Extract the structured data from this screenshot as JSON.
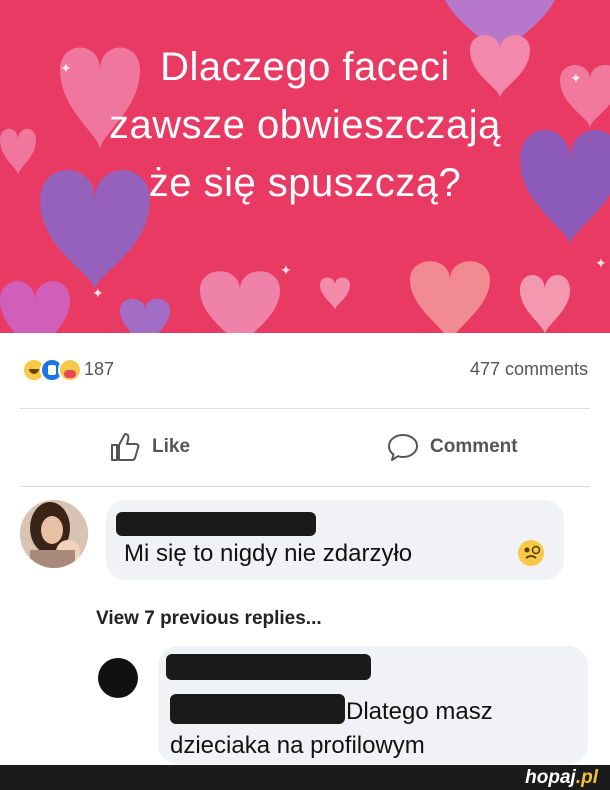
{
  "post": {
    "banner_title_lines": [
      "Dlaczego faceci",
      "zawsze obwieszczają",
      "że się spuszczą?"
    ],
    "reaction_count": "187",
    "comment_count": "477 comments"
  },
  "actions": {
    "like_label": "Like",
    "comment_label": "Comment"
  },
  "comments": {
    "first_text": "Mi się to nigdy nie zdarzyło",
    "view_previous": "View 7 previous replies...",
    "reply_line1": "Dlatego masz",
    "reply_line2": "dzieciaka na profilowym"
  },
  "footer": {
    "brand_name": "hopaj",
    "brand_tld": ".pl"
  },
  "icons": [
    "haha-reaction-icon",
    "like-reaction-icon",
    "care-reaction-icon",
    "thumbs-up-icon",
    "speech-bubble-icon",
    "grimace-emoji-icon"
  ],
  "colors": {
    "banner_background": "#e93a63",
    "like_reaction": "#1b74e4",
    "reaction_yellow": "#f7c948",
    "comment_bubble": "#f0f2f5",
    "footer": "#1b1b1b",
    "brand_accent": "#f2c12e"
  }
}
